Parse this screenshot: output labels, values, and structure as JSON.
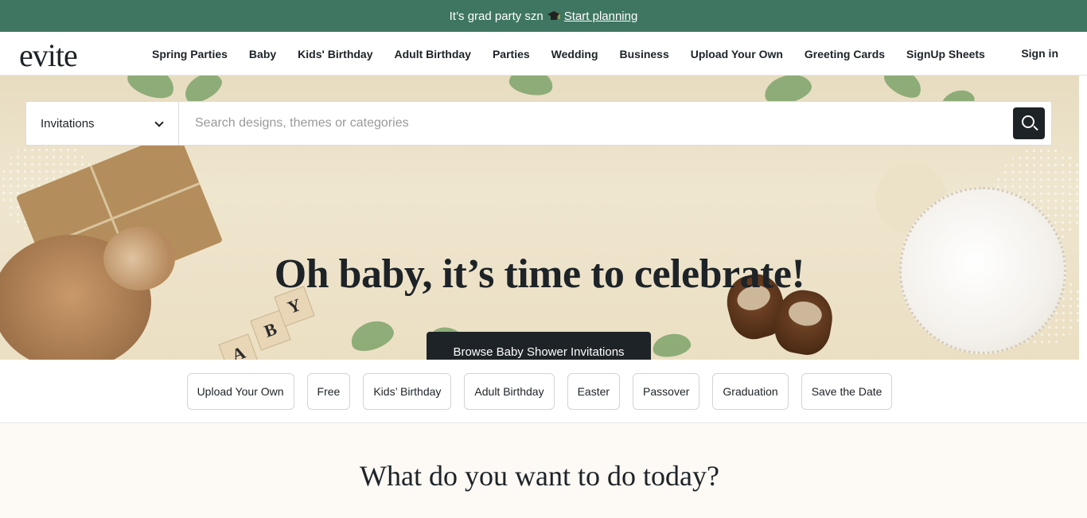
{
  "promo": {
    "text": "It’s grad party szn",
    "icon": "graduation-cap-icon",
    "link": "Start planning"
  },
  "nav": {
    "logo": "evite",
    "links": [
      "Spring Parties",
      "Baby",
      "Kids' Birthday",
      "Adult Birthday",
      "Parties",
      "Wedding",
      "Business",
      "Upload Your Own",
      "Greeting Cards",
      "SignUp Sheets"
    ],
    "signin": "Sign in"
  },
  "search": {
    "category": "Invitations",
    "placeholder": "Search designs, themes or categories",
    "icon": "search-icon"
  },
  "hero": {
    "title": "Oh baby, it’s time to celebrate!",
    "cta": "Browse Baby Shower Invitations",
    "blocks": [
      "B",
      "Y",
      "A"
    ]
  },
  "chips": [
    "Upload Your Own",
    "Free",
    "Kids’ Birthday",
    "Adult Birthday",
    "Easter",
    "Passover",
    "Graduation",
    "Save the Date"
  ],
  "section": {
    "title": "What do you want to do today?"
  },
  "colors": {
    "promo_bg": "#3f7662",
    "dark": "#1d2327",
    "hero_bg": "#ebdfc3",
    "lower_bg": "#fdf9f4"
  }
}
